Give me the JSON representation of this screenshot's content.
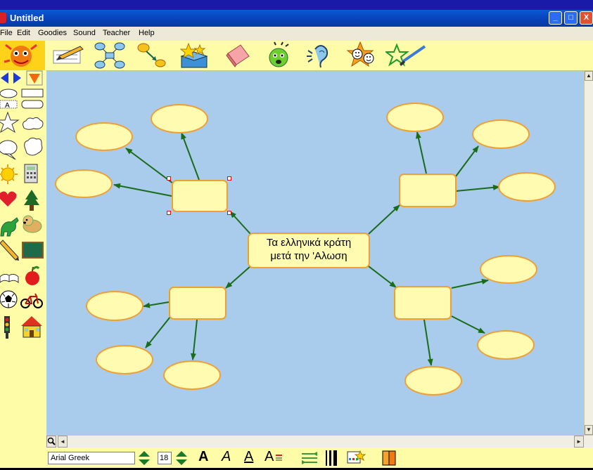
{
  "window": {
    "title": "Untitled",
    "controls": {
      "minimize": "_",
      "maximize": "□",
      "close": "X"
    }
  },
  "menu": [
    "File",
    "Edit",
    "Goodies",
    "Sound",
    "Teacher",
    "Help"
  ],
  "toolbar_icons": [
    "mascot-icon",
    "pencil-paper-icon",
    "diagram-icon",
    "arrow-link-icon",
    "stars-box-icon",
    "eraser-icon",
    "sound-face-icon",
    "ear-icon",
    "faces-icon",
    "star-paintbrush-icon"
  ],
  "symbols_palette": {
    "nav": [
      "prev-arrow-icon",
      "next-arrow-icon",
      "dropdown-arrow-icon"
    ],
    "shapes": [
      "ellipse",
      "rectangle",
      "text",
      "rounded-rectangle",
      "star",
      "cloud",
      "speech-bubble",
      "thought-bubble",
      "sun",
      "calculator",
      "heart",
      "tree",
      "dinosaur",
      "dog",
      "pencil",
      "chalkboard",
      "book",
      "apple",
      "soccer-ball",
      "bicycle",
      "traffic-light",
      "house"
    ],
    "text_label": "A"
  },
  "diagram": {
    "center_node": {
      "line1": "Τα ελληνικά κράτη",
      "line2": "μετά την 'Αλωση"
    }
  },
  "bottom_bar": {
    "font_name": "Arial Greek",
    "font_size": "18",
    "format_labels": {
      "bold": "A",
      "italic": "A",
      "underline": "A",
      "color": "A"
    }
  },
  "scroll": {
    "up": "▲",
    "down": "▼",
    "left": "◄",
    "right": "►",
    "zoom": "🔍"
  },
  "colors": {
    "canvas": "#a9cbec",
    "node_fill": "#fffbb0",
    "node_border": "#f0a033",
    "link": "#1a6b1a",
    "toolbar": "#fffca8",
    "titlebar": "#0842b8"
  }
}
